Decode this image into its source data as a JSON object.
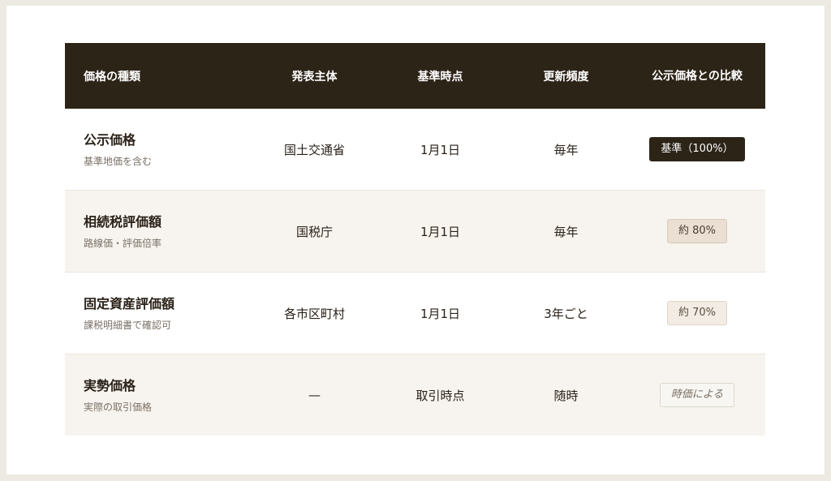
{
  "table": {
    "headers": [
      "価格の種類",
      "発表主体",
      "基準時点",
      "更新頻度",
      "公示価格との比較"
    ],
    "rows": [
      {
        "name": "公示価格",
        "sub": "基準地価を含む",
        "issuer": "国土交通省",
        "base_date": "1月1日",
        "frequency": "毎年",
        "comparison": "基準（100%）"
      },
      {
        "name": "相続税評価額",
        "sub": "路線価・評価倍率",
        "issuer": "国税庁",
        "base_date": "1月1日",
        "frequency": "毎年",
        "comparison": "約 80%"
      },
      {
        "name": "固定資産評価額",
        "sub": "課税明細書で確認可",
        "issuer": "各市区町村",
        "base_date": "1月1日",
        "frequency": "3年ごと",
        "comparison": "約 70%"
      },
      {
        "name": "実勢価格",
        "sub": "実際の取引価格",
        "issuer": "—",
        "base_date": "取引時点",
        "frequency": "随時",
        "comparison": "時価による"
      }
    ]
  }
}
